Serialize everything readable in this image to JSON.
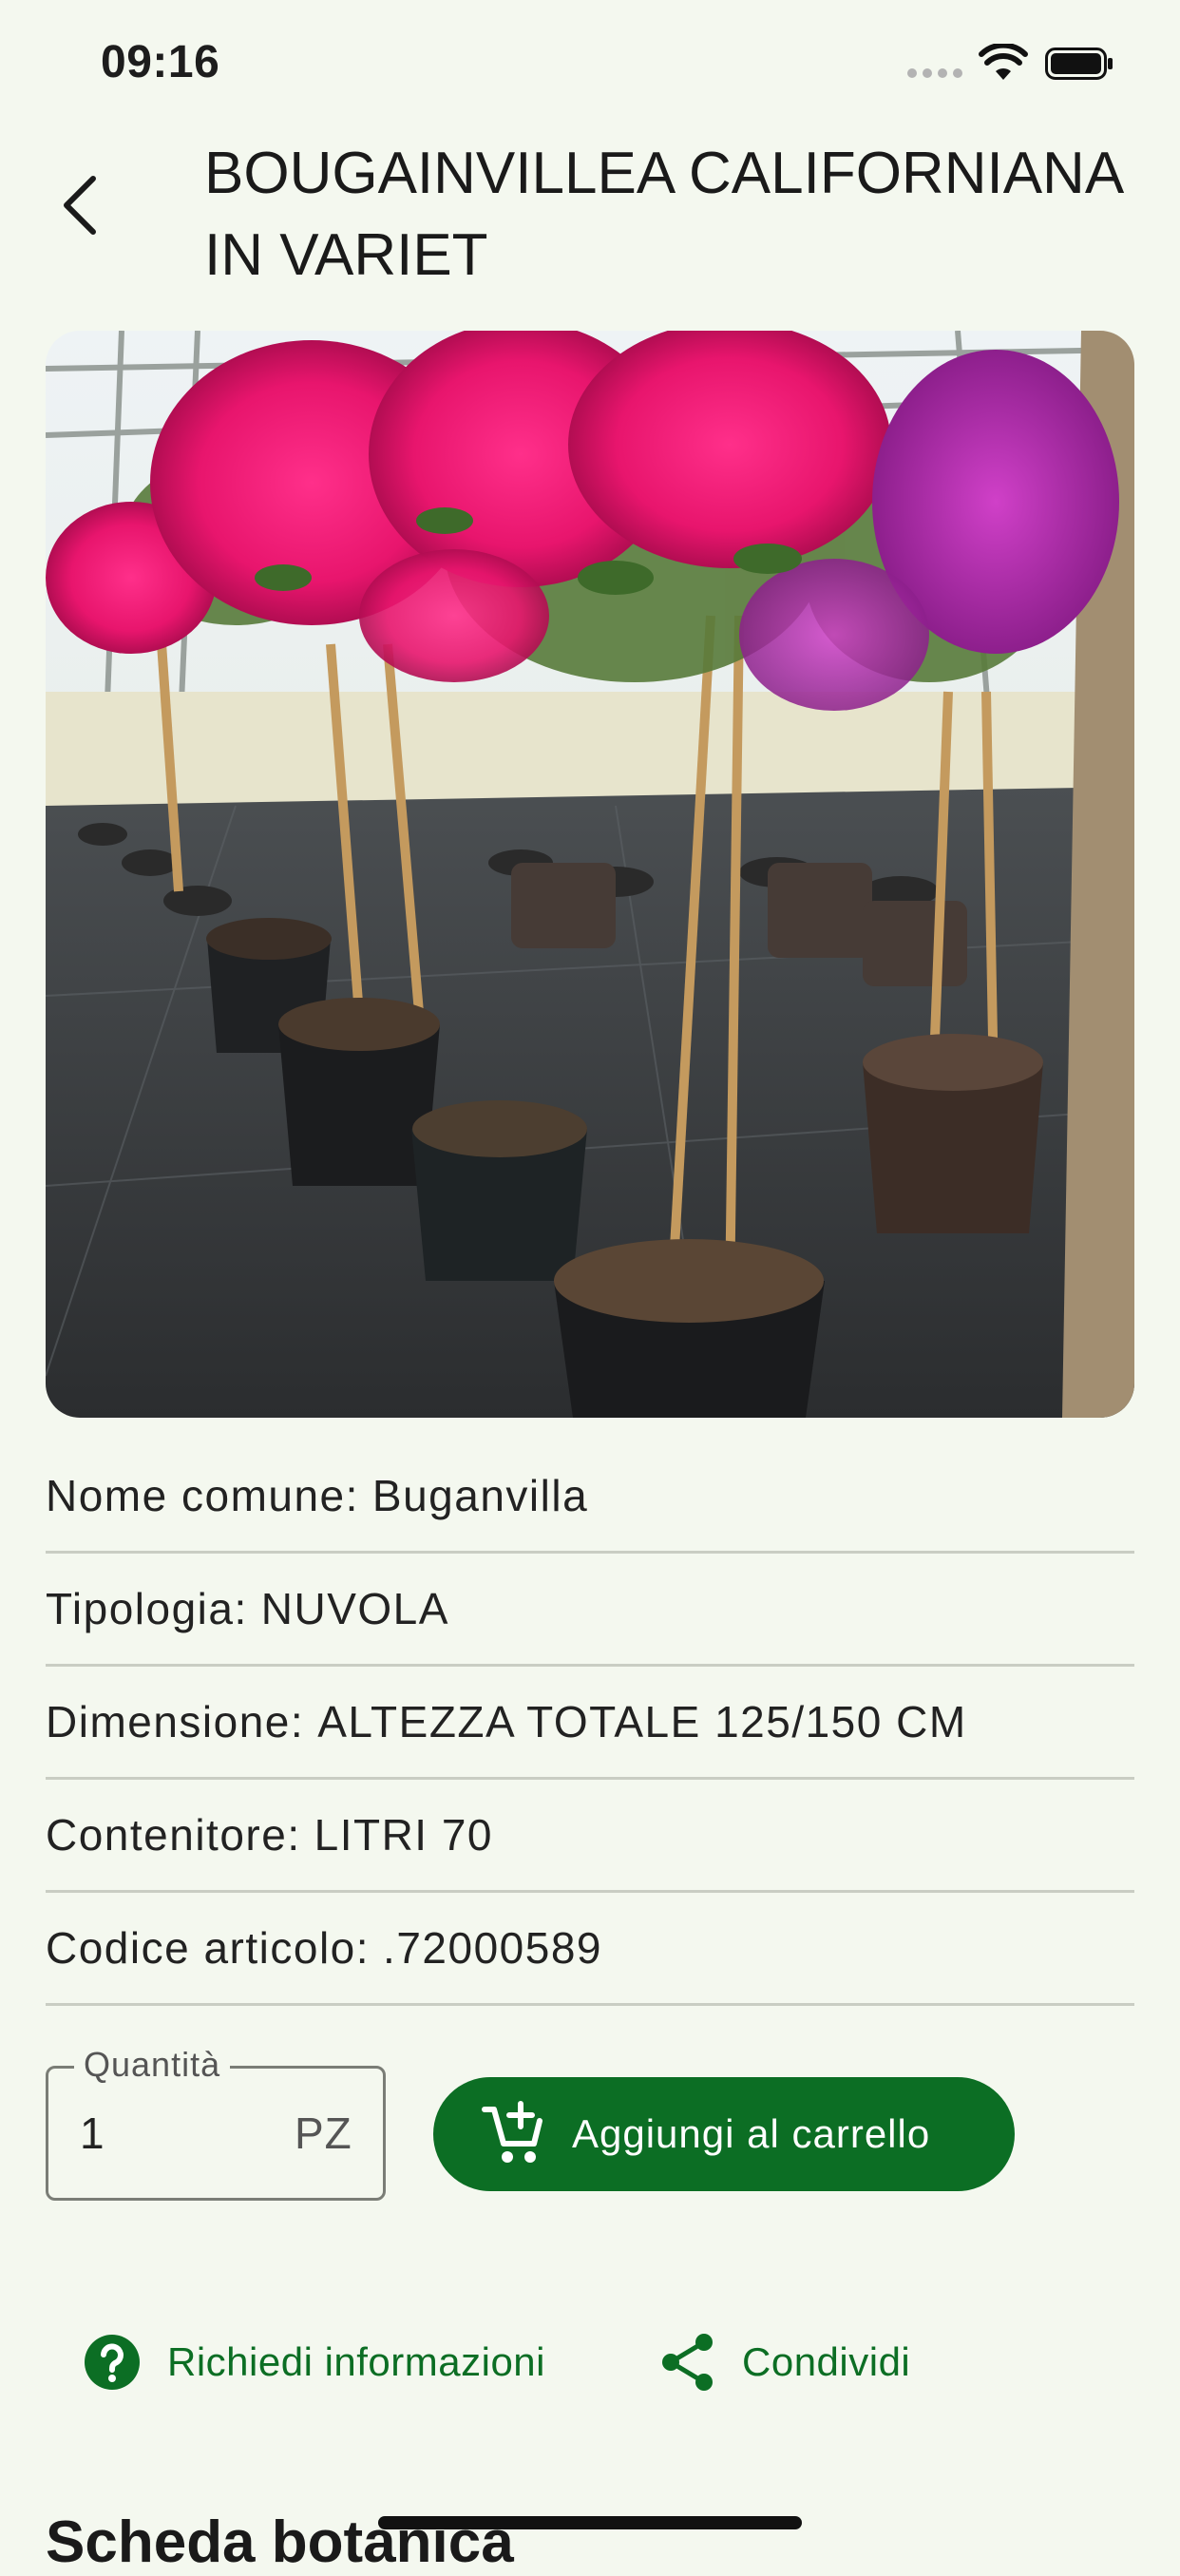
{
  "status_bar": {
    "time": "09:16"
  },
  "header": {
    "title": "BOUGAINVILLEA CALIFORNIANA IN VARIET"
  },
  "details": [
    {
      "label": "Nome comune:",
      "value": "Buganvilla"
    },
    {
      "label": "Tipologia:",
      "value": "NUVOLA"
    },
    {
      "label": "Dimensione:",
      "value": "ALTEZZA TOTALE 125/150 CM"
    },
    {
      "label": "Contenitore:",
      "value": "LITRI 70"
    },
    {
      "label": "Codice articolo:",
      "value": ".72000589"
    }
  ],
  "quantity": {
    "label": "Quantità",
    "value": "1",
    "unit": "PZ"
  },
  "actions": {
    "add_to_cart": "Aggiungi al carrello",
    "request_info": "Richiedi informazioni",
    "share": "Condividi"
  },
  "next_section_title": "Scheda botanica",
  "colors": {
    "accent": "#0c6e24",
    "background": "#f4f8ef"
  },
  "icons": [
    "back-chevron-icon",
    "wifi-icon",
    "battery-icon",
    "add-cart-icon",
    "help-circle-icon",
    "share-icon"
  ]
}
